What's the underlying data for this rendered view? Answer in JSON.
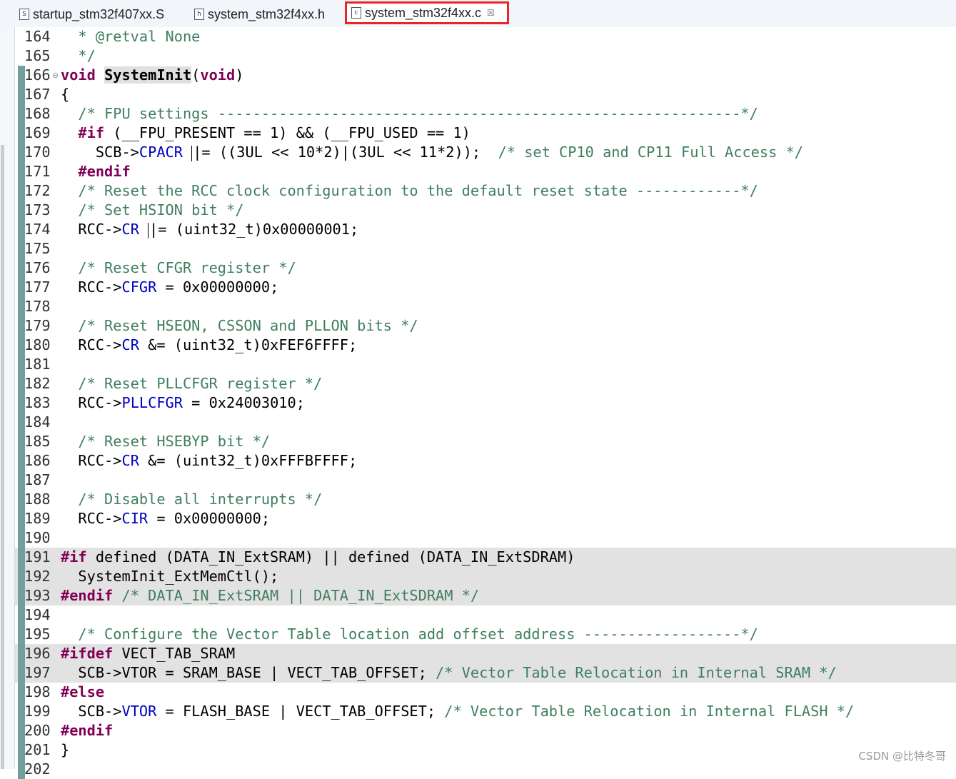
{
  "tabs": [
    {
      "label": "startup_stm32f407xx.S",
      "icon": "S"
    },
    {
      "label": "system_stm32f4xx.h",
      "icon": "h"
    },
    {
      "label": "system_stm32f4xx.c",
      "icon": "c",
      "close": "☒"
    }
  ],
  "watermark": "CSDN @比特冬哥",
  "editor": {
    "lines": [
      {
        "num": "164",
        "segs": [
          [
            "c",
            "  * @retval None"
          ]
        ]
      },
      {
        "num": "165",
        "segs": [
          [
            "c",
            "  */"
          ]
        ]
      },
      {
        "num": "166",
        "fold": true,
        "bar": true,
        "segs": [
          [
            "k",
            "void"
          ],
          [
            "p",
            " "
          ],
          [
            "nm",
            "SystemInit"
          ],
          [
            "p",
            "("
          ],
          [
            "k",
            "void"
          ],
          [
            "p",
            ")"
          ]
        ]
      },
      {
        "num": "167",
        "bar": true,
        "segs": [
          [
            "p",
            "{"
          ]
        ]
      },
      {
        "num": "168",
        "bar": true,
        "segs": [
          [
            "p",
            "  "
          ],
          [
            "c",
            "/* FPU settings ------------------------------------------------------------*/"
          ]
        ]
      },
      {
        "num": "169",
        "bar": true,
        "segs": [
          [
            "p",
            "  "
          ],
          [
            "k",
            "#if"
          ],
          [
            "p",
            " (__FPU_PRESENT == 1) && (__FPU_USED == 1)"
          ]
        ]
      },
      {
        "num": "170",
        "bar": true,
        "segs": [
          [
            "p",
            "    SCB->"
          ],
          [
            "f",
            "CPACR"
          ],
          [
            "p",
            " "
          ],
          [
            "cur",
            ""
          ],
          [
            "p",
            "|= ((3UL << 10*2)|(3UL << 11*2));  "
          ],
          [
            "c",
            "/* set CP10 and CP11 Full Access */"
          ]
        ]
      },
      {
        "num": "171",
        "bar": true,
        "segs": [
          [
            "p",
            "  "
          ],
          [
            "k",
            "#endif"
          ]
        ]
      },
      {
        "num": "172",
        "bar": true,
        "segs": [
          [
            "p",
            "  "
          ],
          [
            "c",
            "/* Reset the RCC clock configuration to the default reset state ------------*/"
          ]
        ]
      },
      {
        "num": "173",
        "bar": true,
        "segs": [
          [
            "p",
            "  "
          ],
          [
            "c",
            "/* Set HSION bit */"
          ]
        ]
      },
      {
        "num": "174",
        "bar": true,
        "segs": [
          [
            "p",
            "  RCC->"
          ],
          [
            "f",
            "CR"
          ],
          [
            "p",
            " "
          ],
          [
            "cur",
            ""
          ],
          [
            "p",
            "|= (uint32_t)0x00000001;"
          ]
        ]
      },
      {
        "num": "175",
        "bar": true,
        "segs": []
      },
      {
        "num": "176",
        "bar": true,
        "segs": [
          [
            "p",
            "  "
          ],
          [
            "c",
            "/* Reset CFGR register */"
          ]
        ]
      },
      {
        "num": "177",
        "bar": true,
        "segs": [
          [
            "p",
            "  RCC->"
          ],
          [
            "f",
            "CFGR"
          ],
          [
            "p",
            " = 0x00000000;"
          ]
        ]
      },
      {
        "num": "178",
        "bar": true,
        "segs": []
      },
      {
        "num": "179",
        "bar": true,
        "segs": [
          [
            "p",
            "  "
          ],
          [
            "c",
            "/* Reset HSEON, CSSON and PLLON bits */"
          ]
        ]
      },
      {
        "num": "180",
        "bar": true,
        "segs": [
          [
            "p",
            "  RCC->"
          ],
          [
            "f",
            "CR"
          ],
          [
            "p",
            " &= (uint32_t)0xFEF6FFFF;"
          ]
        ]
      },
      {
        "num": "181",
        "bar": true,
        "segs": []
      },
      {
        "num": "182",
        "bar": true,
        "segs": [
          [
            "p",
            "  "
          ],
          [
            "c",
            "/* Reset PLLCFGR register */"
          ]
        ]
      },
      {
        "num": "183",
        "bar": true,
        "segs": [
          [
            "p",
            "  RCC->"
          ],
          [
            "f",
            "PLLCFGR"
          ],
          [
            "p",
            " = 0x24003010;"
          ]
        ]
      },
      {
        "num": "184",
        "bar": true,
        "segs": []
      },
      {
        "num": "185",
        "bar": true,
        "segs": [
          [
            "p",
            "  "
          ],
          [
            "c",
            "/* Reset HSEBYP bit */"
          ]
        ]
      },
      {
        "num": "186",
        "bar": true,
        "segs": [
          [
            "p",
            "  RCC->"
          ],
          [
            "f",
            "CR"
          ],
          [
            "p",
            " &= (uint32_t)0xFFFBFFFF;"
          ]
        ]
      },
      {
        "num": "187",
        "bar": true,
        "segs": []
      },
      {
        "num": "188",
        "bar": true,
        "segs": [
          [
            "p",
            "  "
          ],
          [
            "c",
            "/* Disable all interrupts */"
          ]
        ]
      },
      {
        "num": "189",
        "bar": true,
        "segs": [
          [
            "p",
            "  RCC->"
          ],
          [
            "f",
            "CIR"
          ],
          [
            "p",
            " = 0x00000000;"
          ]
        ]
      },
      {
        "num": "190",
        "bar": true,
        "segs": []
      },
      {
        "num": "191",
        "bar": true,
        "hl": true,
        "segs": [
          [
            "k",
            "#if"
          ],
          [
            "p",
            " defined (DATA_IN_ExtSRAM) || defined (DATA_IN_ExtSDRAM)"
          ]
        ]
      },
      {
        "num": "192",
        "bar": true,
        "hl": true,
        "segs": [
          [
            "p",
            "  SystemInit_ExtMemCtl();"
          ]
        ]
      },
      {
        "num": "193",
        "bar": true,
        "hl": true,
        "segs": [
          [
            "k",
            "#endif"
          ],
          [
            "p",
            " "
          ],
          [
            "c",
            "/* DATA_IN_ExtSRAM || DATA_IN_ExtSDRAM */"
          ]
        ]
      },
      {
        "num": "194",
        "bar": true,
        "segs": []
      },
      {
        "num": "195",
        "bar": true,
        "segs": [
          [
            "p",
            "  "
          ],
          [
            "c",
            "/* Configure the Vector Table location add offset address ------------------*/"
          ]
        ]
      },
      {
        "num": "196",
        "bar": true,
        "hl": true,
        "segs": [
          [
            "k",
            "#ifdef"
          ],
          [
            "p",
            " VECT_TAB_SRAM"
          ]
        ]
      },
      {
        "num": "197",
        "bar": true,
        "hl": true,
        "segs": [
          [
            "p",
            "  SCB->VTOR = SRAM_BASE | VECT_TAB_OFFSET; "
          ],
          [
            "c",
            "/* Vector Table Relocation in Internal SRAM */"
          ]
        ]
      },
      {
        "num": "198",
        "bar": true,
        "segs": [
          [
            "k",
            "#else"
          ]
        ]
      },
      {
        "num": "199",
        "bar": true,
        "segs": [
          [
            "p",
            "  SCB->"
          ],
          [
            "f",
            "VTOR"
          ],
          [
            "p",
            " = FLASH_BASE | VECT_TAB_OFFSET; "
          ],
          [
            "c",
            "/* Vector Table Relocation in Internal FLASH */"
          ]
        ]
      },
      {
        "num": "200",
        "bar": true,
        "segs": [
          [
            "k",
            "#endif"
          ]
        ]
      },
      {
        "num": "201",
        "bar": true,
        "segs": [
          [
            "p",
            "}"
          ]
        ]
      },
      {
        "num": "202",
        "bar": true,
        "segs": []
      }
    ]
  }
}
